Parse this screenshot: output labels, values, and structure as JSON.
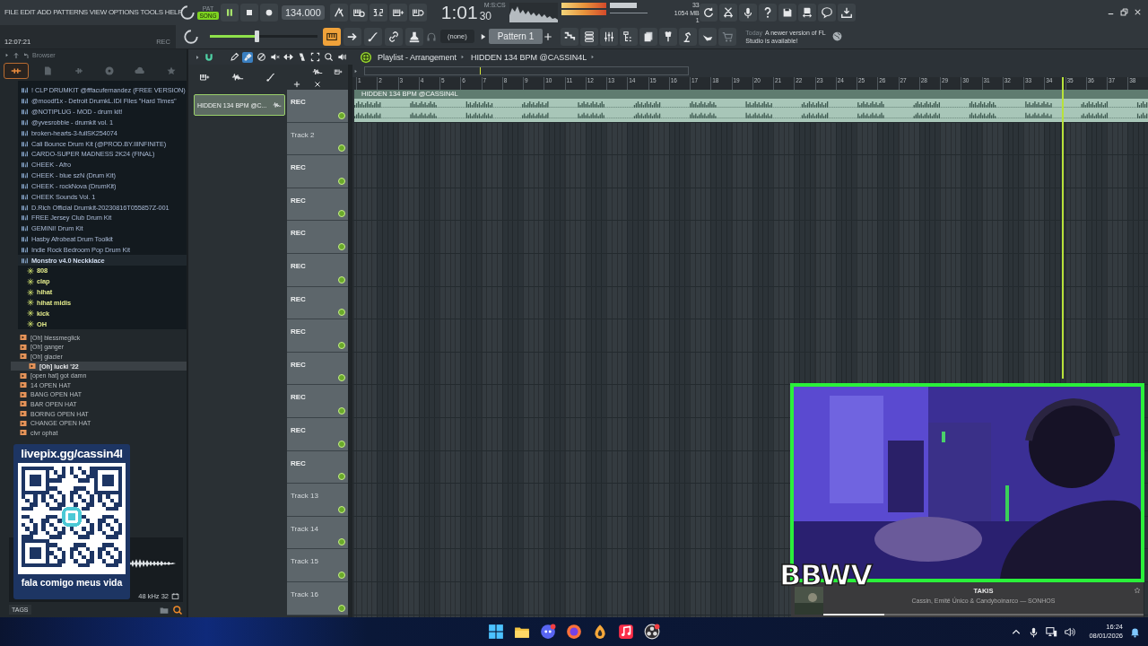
{
  "menu": [
    "FILE",
    "EDIT",
    "ADD",
    "PATTERNS",
    "VIEW",
    "OPTIONS",
    "TOOLS",
    "HELP"
  ],
  "transport": {
    "pat": "PAT",
    "song": "SONG",
    "song_selected": true,
    "tempo": "134.000",
    "time": "1:01",
    "time_small": "30",
    "time_unit": "M:S:CS"
  },
  "hint": {
    "clock": "12:07:21",
    "rec": "REC"
  },
  "monitor": {
    "cpu": "33",
    "memory": "1054 MB",
    "polyphony": "1"
  },
  "master_volume": {
    "level": 0.43
  },
  "modes": [
    {
      "kind": "pattern",
      "selected": true
    },
    {
      "kind": "arrow",
      "selected": false
    },
    {
      "kind": "curve",
      "selected": false
    },
    {
      "kind": "link",
      "selected": false
    },
    {
      "kind": "stamp",
      "selected": false
    }
  ],
  "pattern": {
    "channel": "(none)",
    "name": "Pattern 1"
  },
  "news": {
    "date": "Today",
    "text": "A newer version of FL Studio is available!"
  },
  "browser": {
    "title": "Browser",
    "items": [
      {
        "label": "! CLP DRUMKIT @fffacufernandez (FREE VERSION)"
      },
      {
        "label": "@moodf1x - Detroit DrumkL.IDI Files \"Hard Times\""
      },
      {
        "label": "@NOTIPLUG - MOD - drum kit!"
      },
      {
        "label": "@yvesrobbie - drumkit vol. 1"
      },
      {
        "label": "broken-hearts-3-fullSK254074"
      },
      {
        "label": "Cali Bounce Drum Kit (@PROD.BY.IIINFINITE)"
      },
      {
        "label": "CARDO-SUPER MADNESS 2K24 (FINAL)"
      },
      {
        "label": "CHEEK - Afro"
      },
      {
        "label": "CHEEK - blue szN (Drum Kit)"
      },
      {
        "label": "CHEEK - rockNova (DrumKit)"
      },
      {
        "label": "CHEEK Sounds Vol. 1"
      },
      {
        "label": "D.Rich Official Drumkit-20230816T055857Z-001"
      },
      {
        "label": "FREE Jersey Club Drum Kit"
      },
      {
        "label": "GEMINI! Drum Kit"
      },
      {
        "label": "Hasby Afrobeat Drum Toolkit"
      },
      {
        "label": "Indie Rock Bedroom Pop Drum Kit"
      },
      {
        "label": "Monstro v4.0 Neckklace",
        "children": [
          {
            "label": "808"
          },
          {
            "label": "clap"
          },
          {
            "label": "hihat"
          },
          {
            "label": "hihat midis"
          },
          {
            "label": "kick"
          },
          {
            "label": "OH"
          }
        ]
      }
    ],
    "files": [
      {
        "label": "[Oh] blessmeglick",
        "selected": false
      },
      {
        "label": "[Oh] ganger",
        "selected": false
      },
      {
        "label": "[Oh] glacier",
        "selected": false
      },
      {
        "label": "[Oh] lucki '22",
        "selected": true
      },
      {
        "label": "[open hat] got damn",
        "selected": false
      },
      {
        "label": "14 OPEN HAT",
        "selected": false
      },
      {
        "label": "BANG OPEN HAT",
        "selected": false
      },
      {
        "label": "BAR OPEN HAT",
        "selected": false
      },
      {
        "label": "BORING OPEN HAT",
        "selected": false
      },
      {
        "label": "CHANGE OPEN HAT",
        "selected": false
      },
      {
        "label": "clvr ophat",
        "selected": false
      }
    ],
    "sample_info": "48 kHz 32",
    "tags": "TAGS"
  },
  "playlist": {
    "title": "Playlist - Arrangement",
    "pattern": "HIDDEN 134 BPM @CASSIN4L",
    "tools": [
      {
        "kind": "pencil",
        "selected": false
      },
      {
        "kind": "brush",
        "selected": true
      },
      {
        "kind": "delete",
        "selected": false
      },
      {
        "kind": "mute",
        "selected": false
      },
      {
        "kind": "slip",
        "selected": false
      },
      {
        "kind": "slice",
        "selected": false
      },
      {
        "kind": "select",
        "selected": false
      },
      {
        "kind": "zoom",
        "selected": false
      },
      {
        "kind": "playback",
        "selected": false
      }
    ],
    "picker": [
      {
        "label": "HIDDEN 134 BPM @C...",
        "selected": true
      }
    ],
    "ruler": [
      "1",
      "2",
      "3",
      "4",
      "5",
      "6",
      "7",
      "8",
      "9",
      "10",
      "11",
      "12",
      "13",
      "14",
      "15",
      "16",
      "17",
      "18",
      "19",
      "20",
      "21",
      "22",
      "23",
      "24",
      "25",
      "26",
      "27",
      "28",
      "29",
      "30",
      "31",
      "32",
      "33",
      "34",
      "35",
      "36",
      "37",
      "38"
    ],
    "playhead": {
      "level": 0.892
    },
    "clip": {
      "label": "HIDDEN 134 BPM @CASSIN4L"
    },
    "tracks": [
      {
        "name": "REC",
        "named": true
      },
      {
        "name": "Track 2",
        "named": false
      },
      {
        "name": "REC",
        "named": true
      },
      {
        "name": "REC",
        "named": true
      },
      {
        "name": "REC",
        "named": true
      },
      {
        "name": "REC",
        "named": true
      },
      {
        "name": "REC",
        "named": true
      },
      {
        "name": "REC",
        "named": true
      },
      {
        "name": "REC",
        "named": true
      },
      {
        "name": "REC",
        "named": true
      },
      {
        "name": "REC",
        "named": true
      },
      {
        "name": "REC",
        "named": true
      },
      {
        "name": "Track 13",
        "named": false
      },
      {
        "name": "Track 14",
        "named": false
      },
      {
        "name": "Track 15",
        "named": false
      },
      {
        "name": "Track 16",
        "named": false
      }
    ]
  },
  "overlay": {
    "qr_url": "livepix.gg/cassin4l",
    "qr_caption": "fala comigo meus vida",
    "logo": "BBWV"
  },
  "now_playing": {
    "title": "TAKIS",
    "artist": "Cassin, Emitê Único & Candyboinarco — SONHOS",
    "level": 0.19
  },
  "taskbar": {
    "time": "16:24",
    "date": "08/01/2026"
  }
}
